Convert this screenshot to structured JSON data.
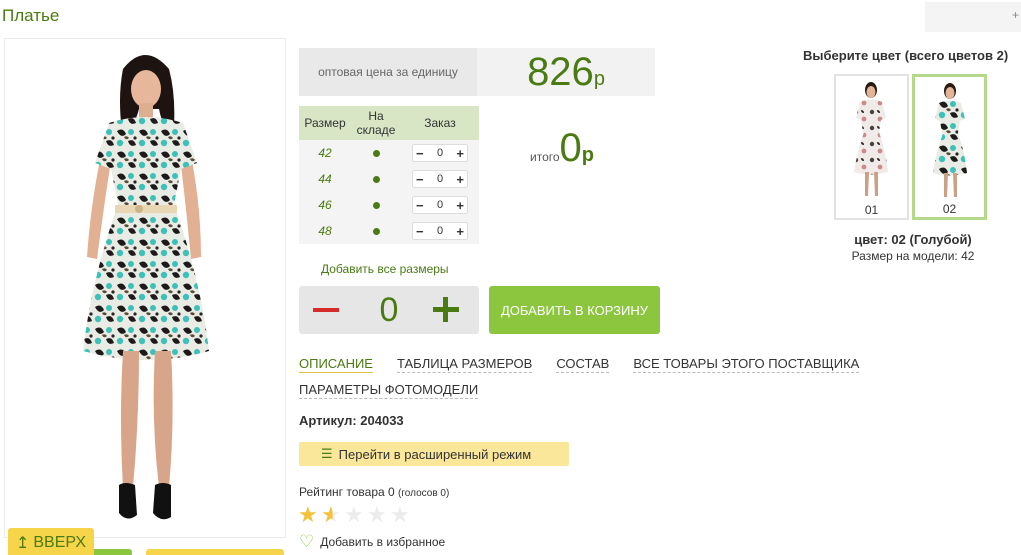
{
  "product": {
    "title": "Платье",
    "top_corner_label": "+"
  },
  "price": {
    "label": "оптовая цена за единицу",
    "value": "826",
    "currency": "р"
  },
  "sizes_table": {
    "headers": [
      "Размер",
      "На складе",
      "Заказ"
    ],
    "rows": [
      {
        "size": "42",
        "qty": "0"
      },
      {
        "size": "44",
        "qty": "0"
      },
      {
        "size": "46",
        "qty": "0"
      },
      {
        "size": "48",
        "qty": "0"
      }
    ],
    "stepper_minus": "−",
    "stepper_plus": "+"
  },
  "total": {
    "label": "итого",
    "value": "0",
    "currency": "р"
  },
  "add_all_sizes": "Добавить все размеры",
  "quantity": {
    "value": "0"
  },
  "add_to_cart": "ДОБАВИТЬ В КОРЗИНУ",
  "tabs": [
    {
      "label": "ОПИСАНИЕ",
      "active": true
    },
    {
      "label": "ТАБЛИЦА РАЗМЕРОВ",
      "active": false
    },
    {
      "label": "СОСТАВ",
      "active": false
    },
    {
      "label": "ВСЕ ТОВАРЫ ЭТОГО ПОСТАВЩИКА",
      "active": false
    },
    {
      "label": "ПАРАМЕТРЫ ФОТОМОДЕЛИ",
      "active": false
    }
  ],
  "artikul": "Артикул: 204033",
  "extended_mode": "Перейти в расширенный режим",
  "rating": {
    "text": "Рейтинг товара 0",
    "votes": "(голосов 0)",
    "stars": 1.5,
    "max": 5
  },
  "favorites": "Добавить в избранное",
  "scroll_up": "ВВЕРХ",
  "color_chooser": {
    "title": "Выберите цвет (всего цветов 2)",
    "options": [
      {
        "label": "01",
        "selected": false
      },
      {
        "label": "02",
        "selected": true
      }
    ],
    "selected_name": "цвет: 02 (Голубой)",
    "model_size": "Размер на модели: 42"
  },
  "colors": {
    "brand_green": "#4a7a12",
    "button_green": "#8cc63f",
    "button_yellow": "#fbe79a",
    "minus_red": "#d62b2b"
  }
}
